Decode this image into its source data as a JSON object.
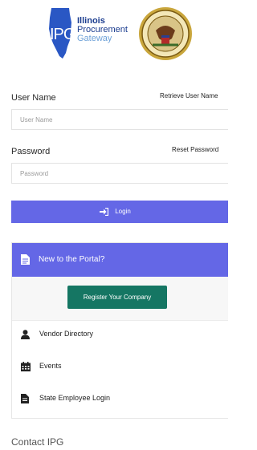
{
  "logo": {
    "initials": "IPG",
    "name_line1": "Illinois",
    "name_line2": "Procurement",
    "name_line3": "Gateway",
    "seal_icon": "state-seal"
  },
  "login": {
    "username_label": "User Name",
    "retrieve_username": "Retrieve User Name",
    "username_placeholder": "User Name",
    "password_label": "Password",
    "reset_password": "Reset Password",
    "password_placeholder": "Password",
    "login_button": "Login",
    "login_icon": "sign-in-icon"
  },
  "portal": {
    "header": "New to the Portal?",
    "header_icon": "document-icon",
    "register_button": "Register Your Company",
    "items": [
      {
        "label": "Vendor Directory",
        "icon": "user-icon"
      },
      {
        "label": "Events",
        "icon": "calendar-icon"
      },
      {
        "label": "State Employee Login",
        "icon": "document-icon"
      }
    ]
  },
  "footer": {
    "contact": "Contact IPG"
  },
  "colors": {
    "accent": "#6467e6",
    "register_green": "#157663",
    "brand_blue": "#1b3c8f"
  }
}
